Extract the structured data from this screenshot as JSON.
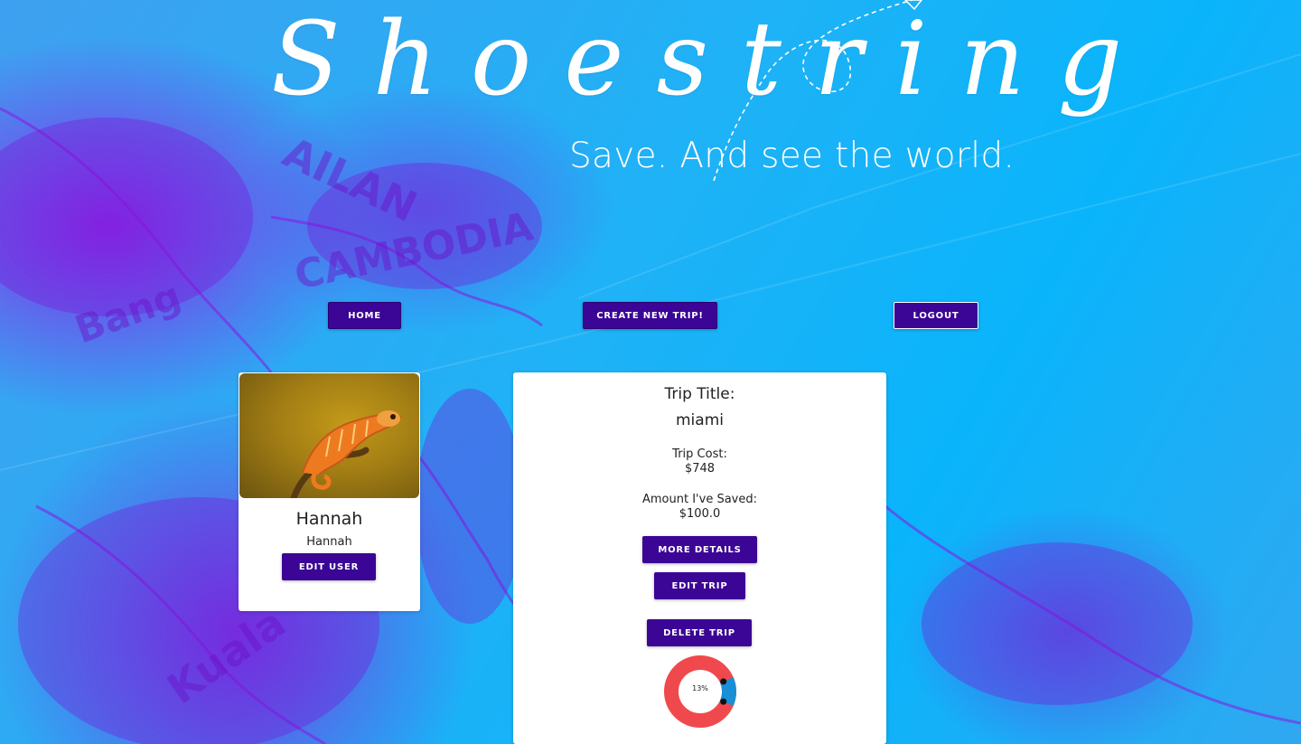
{
  "brand": {
    "title": "Shoestring",
    "tagline": "Save. And see the world."
  },
  "nav": {
    "home": "HOME",
    "create": "CREATE NEW TRIP!",
    "logout": "LOGOUT"
  },
  "user": {
    "name": "Hannah",
    "username": "Hannah",
    "edit_label": "EDIT USER"
  },
  "trip": {
    "title_label": "Trip Title:",
    "title": "miami",
    "cost_label": "Trip Cost:",
    "cost": "$748",
    "saved_label": "Amount I've Saved:",
    "saved": "$100.0",
    "details_label": "MORE DETAILS",
    "edit_label": "EDIT TRIP",
    "delete_label": "DELETE TRIP",
    "progress_percent": 13,
    "progress_label": "13%"
  },
  "colors": {
    "button": "#3b0595",
    "donut_remaining": "#f0494d",
    "donut_saved": "#1a8fd6"
  }
}
